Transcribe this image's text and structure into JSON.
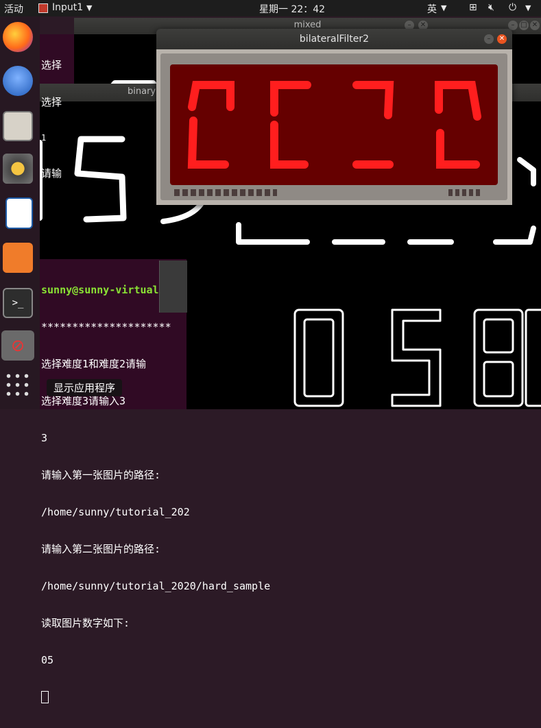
{
  "topbar": {
    "activities": "活动",
    "app_menu": "Input1",
    "clock": "星期一 22：42",
    "input_method": "英"
  },
  "windows": {
    "mixed": {
      "title": "mixed"
    },
    "binary": {
      "title": "binary"
    },
    "bilateral": {
      "title": "bilateralFilter2"
    }
  },
  "background_terminal": {
    "lines": [
      "选择",
      "选择",
      "1",
      "请输"
    ]
  },
  "terminal": {
    "prompt": "sunny@sunny-virtual",
    "lines": [
      "*********************",
      "选择难度1和难度2请输",
      "选择难度3请输入3",
      "3",
      "请输入第一张图片的路径:",
      "/home/sunny/tutorial_202",
      "请输入第二张图片的路径:",
      "/home/sunny/tutorial_2020/hard_sample",
      "读取图片数字如下:",
      "05"
    ]
  },
  "tooltip": {
    "text": "显示应用程序"
  },
  "dock": {
    "items": [
      "firefox-icon",
      "thunderbird-icon",
      "files-icon",
      "rhythmbox-icon",
      "writer-icon",
      "software-icon",
      "terminal-icon",
      "blocked-icon",
      "show-apps-icon"
    ]
  },
  "colors": {
    "led_red": "#ff1e1e",
    "panel_bg": "#650000",
    "prompt_green": "#8ae234"
  }
}
